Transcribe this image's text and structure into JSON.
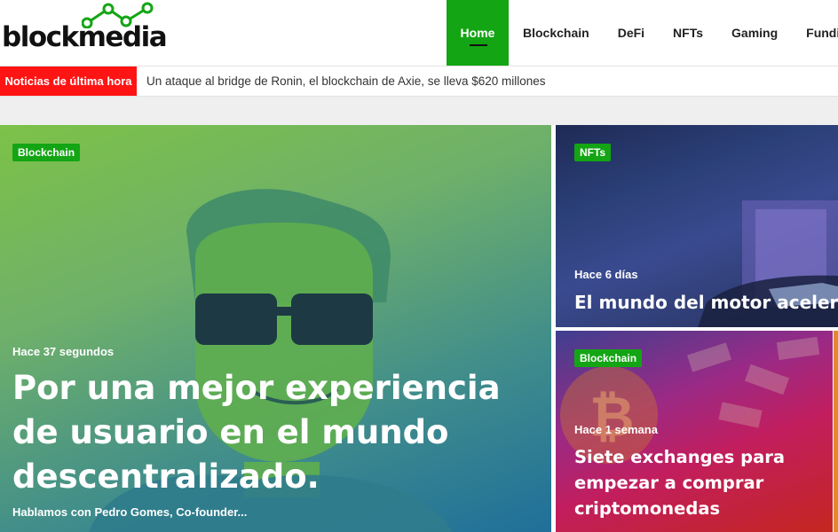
{
  "brand": {
    "logo_text": "blockmedia",
    "accent": "#14a514",
    "alert": "#ff1414"
  },
  "nav": {
    "items": [
      {
        "label": "Home",
        "active": true
      },
      {
        "label": "Blockchain"
      },
      {
        "label": "DeFi"
      },
      {
        "label": "NFTs"
      },
      {
        "label": "Gaming"
      },
      {
        "label": "Fundin"
      }
    ]
  },
  "ticker": {
    "label": "Noticias de última hora",
    "text": "Un ataque al bridge de Ronin, el blockchain de Axie, se lleva $620 millones"
  },
  "featured": {
    "category": "Blockchain",
    "time": "Hace 37 segundos",
    "title": "Por una mejor experiencia de usuario en el mundo descentralizado.",
    "excerpt": "Hablamos con Pedro Gomes, Co-founder..."
  },
  "side_cards": [
    {
      "category": "NFTs",
      "time": "Hace 6 días",
      "title": "El mundo del motor aceler"
    },
    {
      "category": "Blockchain",
      "time": "Hace 1 semana",
      "title": "Siete exchanges para empezar a comprar criptomonedas"
    }
  ]
}
